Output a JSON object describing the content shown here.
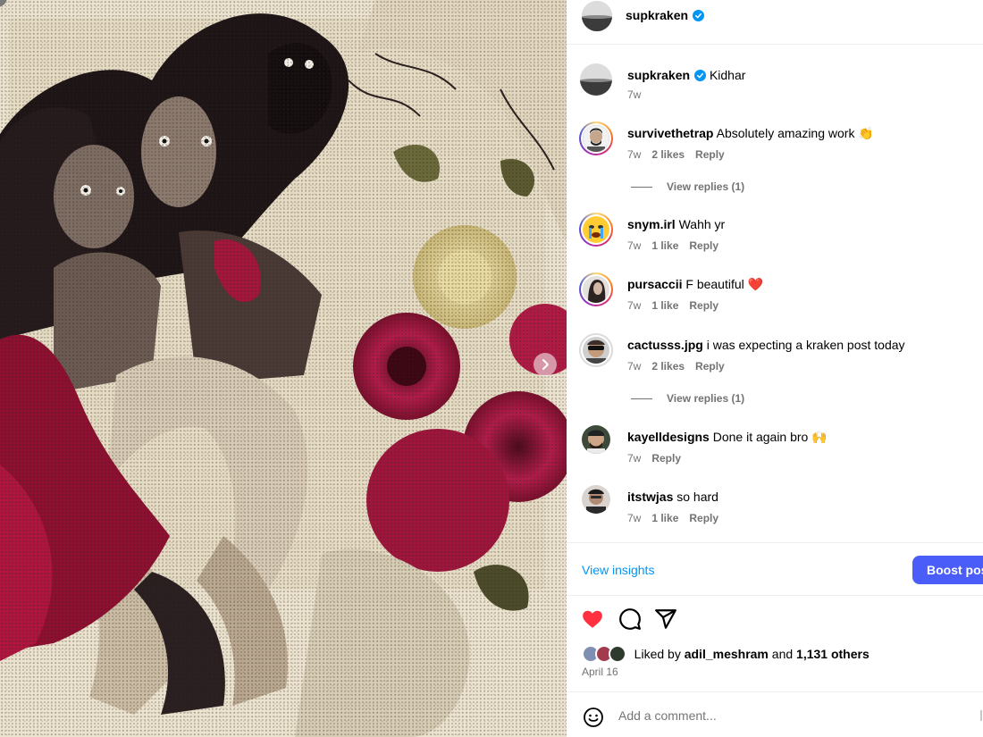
{
  "post": {
    "author": "supkraken",
    "author_verified": true
  },
  "caption": {
    "user": "supkraken",
    "text": "Kidhar",
    "time": "7w"
  },
  "comments": [
    {
      "user": "survivethetrap",
      "text": "Absolutely amazing work 👏",
      "time": "7w",
      "likes": "2 likes",
      "reply": "Reply",
      "view_replies": "View replies (1)"
    },
    {
      "user": "snym.irl",
      "text": "Wahh yr",
      "time": "7w",
      "likes": "1 like",
      "reply": "Reply"
    },
    {
      "user": "pursaccii",
      "text": "F beautiful ❤️",
      "time": "7w",
      "likes": "1 like",
      "reply": "Reply"
    },
    {
      "user": "cactusss.jpg",
      "text": "i was expecting a kraken post today",
      "time": "7w",
      "likes": "2 likes",
      "reply": "Reply",
      "view_replies": "View replies (1)"
    },
    {
      "user": "kayelldesigns",
      "text": "Done it again bro 🙌",
      "time": "7w",
      "reply": "Reply"
    },
    {
      "user": "itstwjas",
      "text": "so hard",
      "time": "7w",
      "likes": "1 like",
      "reply": "Reply"
    }
  ],
  "insights": {
    "view_label": "View insights",
    "boost_label": "Boost post"
  },
  "engagement": {
    "liked_prefix": "Liked by",
    "liked_user": "adil_meshram",
    "liked_and": "and",
    "liked_others": "1,131 others",
    "date": "April 16",
    "liked_state": true
  },
  "composer": {
    "placeholder": "Add a comment..."
  },
  "icons": {
    "like": "heart-icon",
    "comment": "comment-icon",
    "share": "share-icon",
    "emoji": "emoji-icon",
    "next": "chevron-right-icon",
    "verified": "verified-badge-icon"
  },
  "colors": {
    "link": "#0095f6",
    "boost": "#4a5df9",
    "heart": "#ff3040",
    "verified": "#0095f6",
    "muted": "#737373"
  }
}
